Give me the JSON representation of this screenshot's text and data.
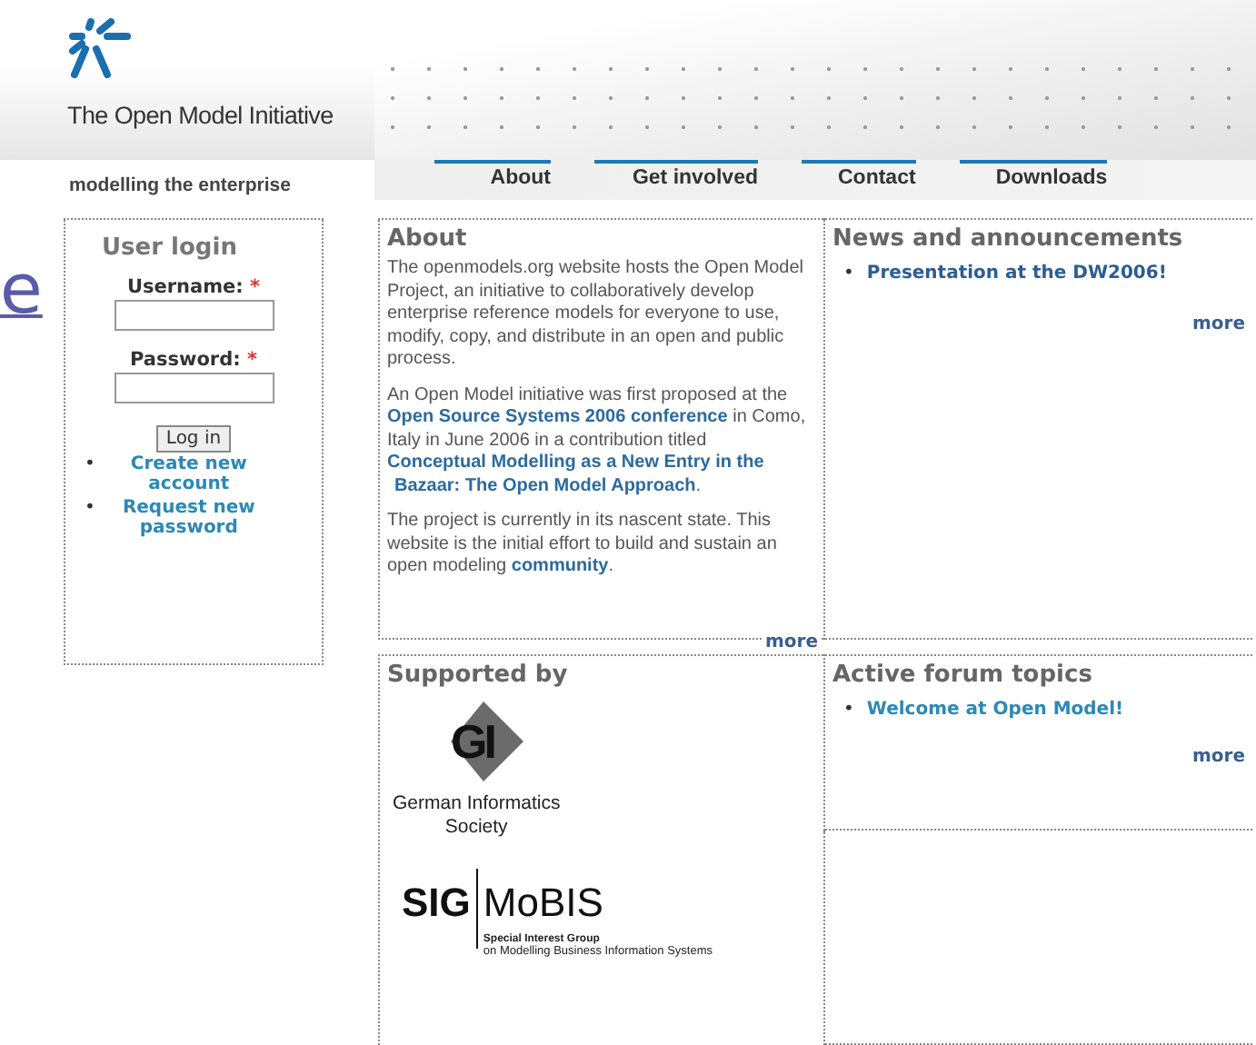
{
  "stray_link": "e",
  "site": {
    "name": "The Open Model Initiative",
    "tagline": "modelling the enterprise"
  },
  "nav": [
    {
      "label": "About"
    },
    {
      "label": "Get involved"
    },
    {
      "label": "Contact"
    },
    {
      "label": "Downloads"
    }
  ],
  "login": {
    "title": "User login",
    "fields": [
      {
        "label": "Username:",
        "required_mark": "*"
      },
      {
        "label": "Password:",
        "required_mark": "*"
      }
    ],
    "button": "Log in",
    "bullet": "•",
    "links": [
      "Create new account",
      "Request new password"
    ]
  },
  "about": {
    "title": "About",
    "paragraphs": [
      [
        {
          "kind": "text",
          "text": "The openmodels.org website hosts the Open Model Project, an initiative to collaboratively develop enterprise reference models for everyone to use, modify, copy, and distribute in an open and public process."
        }
      ],
      [
        {
          "kind": "text",
          "text": "An Open Model initiative was first proposed at the "
        },
        {
          "kind": "link",
          "text": "Open Source Systems 2006 conference"
        },
        {
          "kind": "text",
          "text": " in Como, Italy in June 2006 in a contribution titled "
        },
        {
          "kind": "link",
          "text": "Conceptual Modelling as a New Entry in the"
        },
        {
          "kind": "link",
          "text": "Bazaar: The Open Model Approach"
        },
        {
          "kind": "text",
          "text": "."
        }
      ],
      [
        {
          "kind": "text",
          "text": "The project is currently in its nascent state. This website is the initial effort to build and sustain an open modeling "
        },
        {
          "kind": "link",
          "text": "community"
        },
        {
          "kind": "text",
          "text": "."
        }
      ]
    ],
    "more": "more"
  },
  "news": {
    "title": "News and announcements",
    "bullet": "•",
    "items": [
      "Presentation at the DW2006!"
    ],
    "more": "more"
  },
  "supported": {
    "title": "Supported by",
    "sponsors": [
      {
        "kind": "gi",
        "logo_text": "GI",
        "caption_lines": [
          "German Informatics",
          "Society"
        ]
      },
      {
        "kind": "sigmobis",
        "left": "SIG",
        "right": "MoBIS",
        "caption_lines": [
          "Special Interest Group",
          "on Modelling Business Information Systems"
        ]
      }
    ]
  },
  "forum": {
    "title": "Active forum topics",
    "bullet": "•",
    "items": [
      "Welcome at Open Model!"
    ],
    "more": "more"
  }
}
